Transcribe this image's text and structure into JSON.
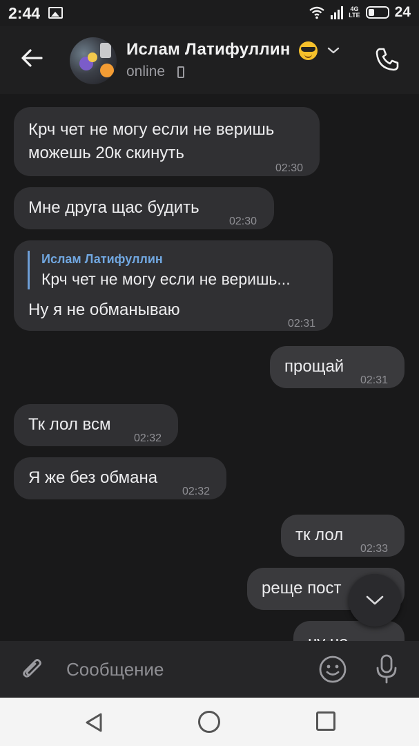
{
  "status_bar": {
    "time": "2:44",
    "network_label": "4G LTE",
    "battery_level": "24"
  },
  "header": {
    "contact_name": "Ислам Латифуллин",
    "status": "online"
  },
  "messages": [
    {
      "direction": "in",
      "text_lines": [
        "Крч чет не могу если не веришь",
        "можешь 20к скинуть"
      ],
      "time": "02:30"
    },
    {
      "direction": "in",
      "text_lines": [
        "Мне друга щас будить"
      ],
      "time": "02:30"
    },
    {
      "direction": "in",
      "reply_to": {
        "name": "Ислам Латифуллин",
        "text": "Крч чет не могу если не веришь..."
      },
      "text_lines": [
        "Ну я не обманываю"
      ],
      "time": "02:31"
    },
    {
      "direction": "out",
      "text_lines": [
        "прощай"
      ],
      "time": "02:31"
    },
    {
      "direction": "in",
      "text_lines": [
        "Тк лол всм"
      ],
      "time": "02:32"
    },
    {
      "direction": "in",
      "text_lines": [
        "Я же без обмана"
      ],
      "time": "02:32"
    },
    {
      "direction": "out",
      "text_lines": [
        "тк лол"
      ],
      "time": "02:33"
    },
    {
      "direction": "out",
      "text_lines": [
        "реще пост"
      ],
      "time": ""
    },
    {
      "direction": "out",
      "text_lines": [
        "ну но"
      ],
      "time": ""
    }
  ],
  "composer": {
    "placeholder": "Сообщение"
  },
  "colors": {
    "background": "#19191a",
    "bubble": "#303033",
    "reply_accent": "#71a7e0"
  }
}
